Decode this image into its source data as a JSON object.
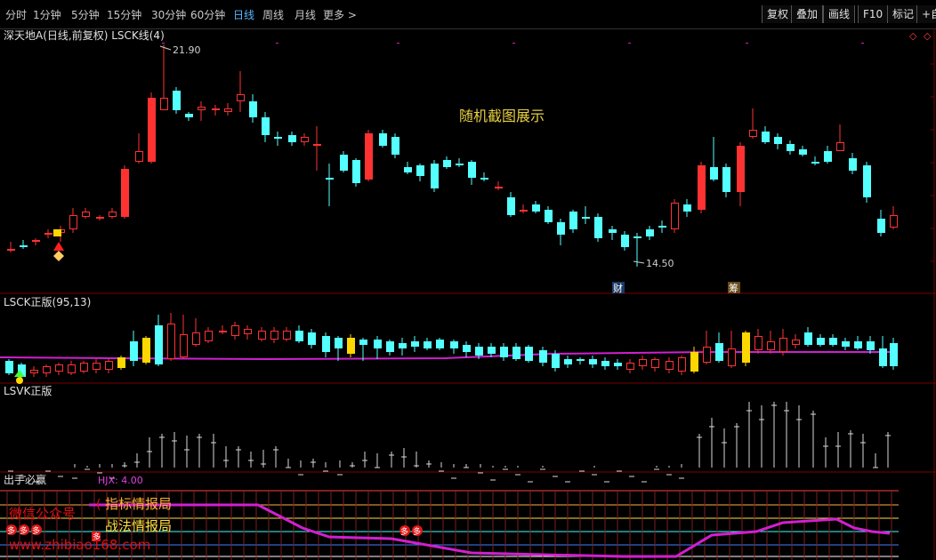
{
  "toolbar": {
    "periods": [
      "分时",
      "1分钟",
      "5分钟",
      "15分钟",
      "30分钟",
      "60分钟",
      "日线",
      "周线",
      "月线"
    ],
    "active_period": "日线",
    "more_label": "更多 >",
    "buttons": [
      "复权",
      "叠加",
      "画线",
      "F10",
      "标记",
      "+自"
    ]
  },
  "main_panel": {
    "title": "深天地A(日线,前复权) LSCK线(4)",
    "high_label": "21.90",
    "low_label": "14.50",
    "watermark_center": "随机截图展示",
    "marker_cai": "财",
    "marker_chou": "筹"
  },
  "panel2": {
    "title": "LSCK正版(95,13)"
  },
  "panel3": {
    "title": "LSVK正版"
  },
  "panel4": {
    "title": "出手必赢",
    "hjx_label": "HJX: 4.00",
    "tag_duo": "多"
  },
  "watermarks": {
    "wechat": "微信公众号",
    "bracket": "(",
    "indicator": "指标情报局",
    "tactics": "战法情报局",
    "site": "www.zhibiao168.com"
  },
  "colors": {
    "up": "#ff3232",
    "down": "#54ffff",
    "purple_line": "#d020d0",
    "accent_blue": "#5ab4ff",
    "yellow": "#ffd700"
  }
}
